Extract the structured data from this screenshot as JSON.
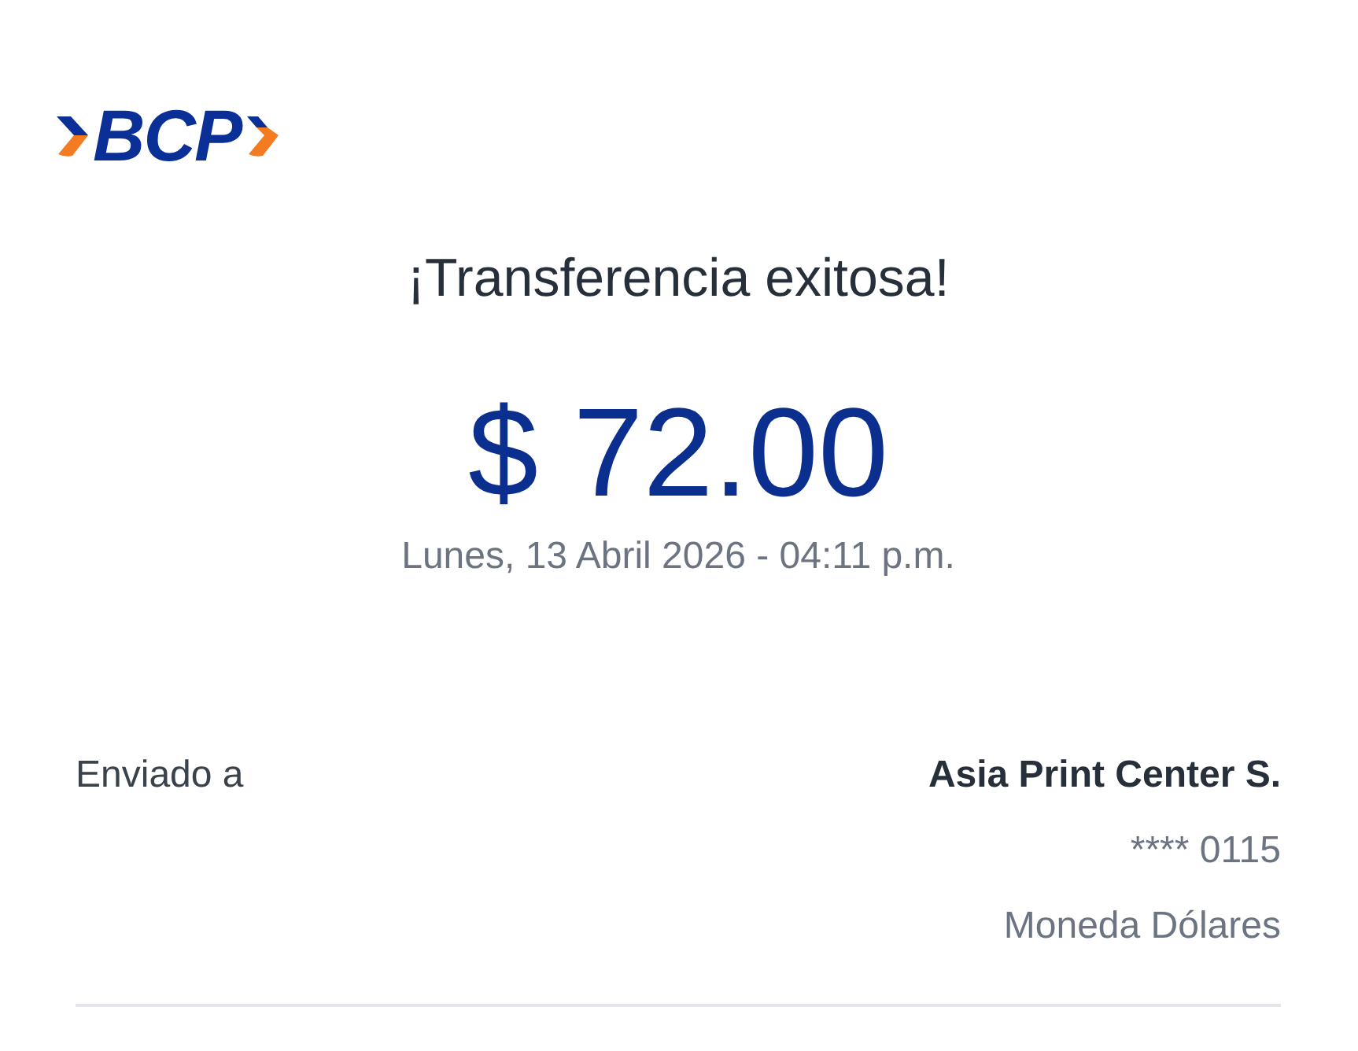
{
  "logo": {
    "text": "BCP"
  },
  "title": "¡Transferencia exitosa!",
  "amount": "$ 72.00",
  "datetime": "Lunes, 13 Abril 2026 - 04:11 p.m.",
  "details": [
    {
      "label": "Enviado a",
      "lines": [
        {
          "kind": "name",
          "text": "Asia Print Center S."
        },
        {
          "kind": "account",
          "text": "**** 0115"
        },
        {
          "kind": "info",
          "text": "Moneda Dólares"
        }
      ]
    }
  ]
}
